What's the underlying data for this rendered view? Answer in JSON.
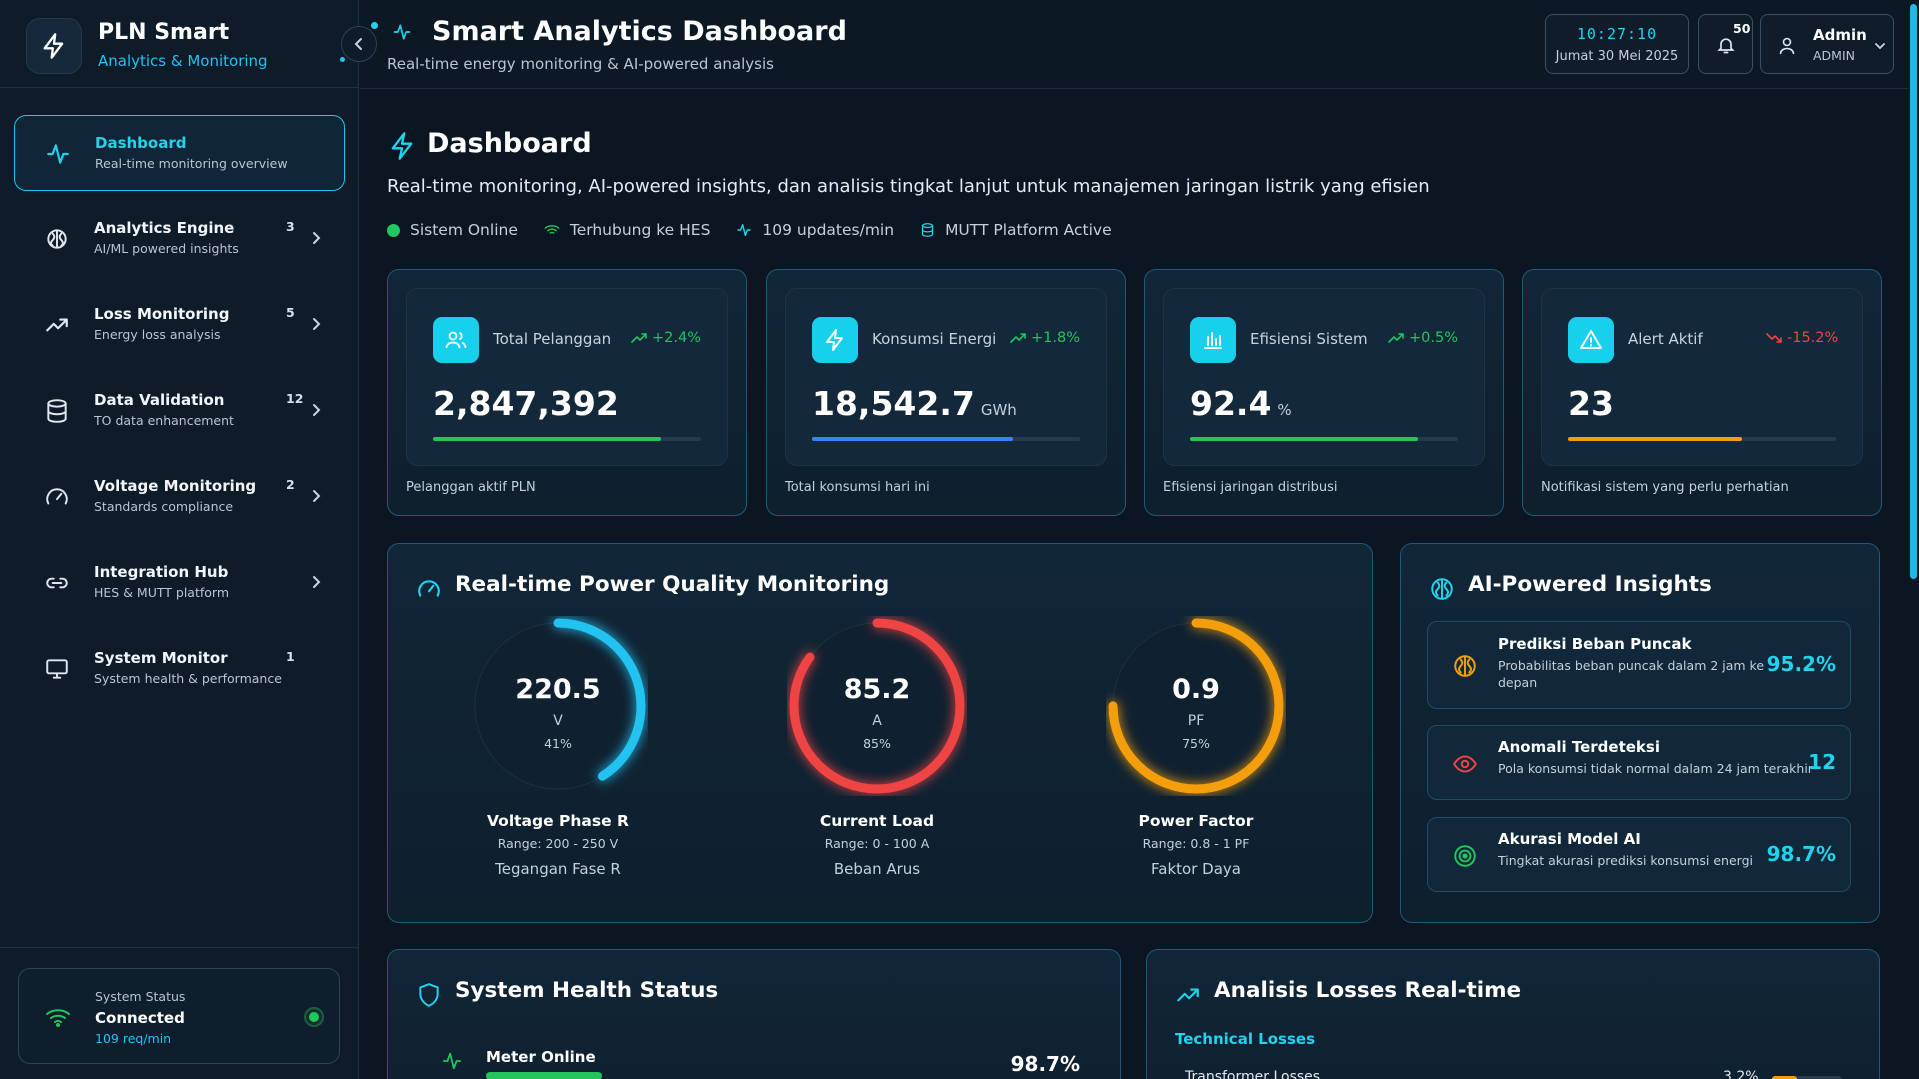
{
  "brand": {
    "title": "PLN Smart",
    "subtitle": "Analytics & Monitoring"
  },
  "sidebar": {
    "items": [
      {
        "label": "Dashboard",
        "desc": "Real-time monitoring overview",
        "badge": "",
        "icon": "activity-icon",
        "active": true
      },
      {
        "label": "Analytics Engine",
        "desc": "AI/ML powered insights",
        "badge": "3",
        "icon": "brain-icon"
      },
      {
        "label": "Loss Monitoring",
        "desc": "Energy loss analysis",
        "badge": "5",
        "icon": "trending-up-icon"
      },
      {
        "label": "Data Validation",
        "desc": "TO data enhancement",
        "badge": "12",
        "icon": "database-icon"
      },
      {
        "label": "Voltage Monitoring",
        "desc": "Standards compliance",
        "badge": "2",
        "icon": "gauge-icon"
      },
      {
        "label": "Integration Hub",
        "desc": "HES & MUTT platform",
        "badge": "",
        "icon": "link-icon"
      },
      {
        "label": "System Monitor",
        "desc": "System health & performance",
        "badge": "1",
        "icon": "monitor-icon"
      }
    ],
    "status": {
      "label": "System Status",
      "value": "Connected",
      "rate": "109 req/min"
    }
  },
  "header": {
    "title": "Smart Analytics Dashboard",
    "subtitle": "Real-time energy monitoring & AI-powered analysis",
    "time": "10:27:10",
    "date": "Jumat 30 Mei 2025",
    "notifications": "50",
    "user_name": "Admin",
    "user_role": "ADMIN"
  },
  "page": {
    "title": "Dashboard",
    "description": "Real-time monitoring, AI-powered insights, dan analisis tingkat lanjut untuk manajemen jaringan listrik yang efisien",
    "status_items": [
      "Sistem Online",
      "Terhubung ke HES",
      "109 updates/min",
      "MUTT Platform Active"
    ]
  },
  "kpis": [
    {
      "label": "Total Pelanggan",
      "trend": "+2.4%",
      "trend_dir": "up",
      "value": "2,847,392",
      "unit": "",
      "progress": 0.85,
      "color": "#22c55e",
      "footer": "Pelanggan aktif PLN",
      "icon": "users-icon"
    },
    {
      "label": "Konsumsi Energi",
      "trend": "+1.8%",
      "trend_dir": "up",
      "value": "18,542.7",
      "unit": "GWh",
      "progress": 0.75,
      "color": "#3b82f6",
      "footer": "Total konsumsi hari ini",
      "icon": "bolt-icon"
    },
    {
      "label": "Efisiensi Sistem",
      "trend": "+0.5%",
      "trend_dir": "up",
      "value": "92.4",
      "unit": "%",
      "progress": 0.85,
      "color": "#22c55e",
      "footer": "Efisiensi jaringan distribusi",
      "icon": "bar-chart-icon"
    },
    {
      "label": "Alert Aktif",
      "trend": "-15.2%",
      "trend_dir": "down",
      "value": "23",
      "unit": "",
      "progress": 0.65,
      "color": "#f59e0b",
      "footer": "Notifikasi sistem yang perlu perhatian",
      "icon": "alert-triangle-icon"
    }
  ],
  "power_quality": {
    "title": "Real-time Power Quality Monitoring",
    "gauges": [
      {
        "value": "220.5",
        "unit": "V",
        "percent_label": "41%",
        "percent": 0.41,
        "name": "Voltage Phase R",
        "range": "Range: 200 - 250 V",
        "sub": "Tegangan Fase R",
        "color": "#22c3f0"
      },
      {
        "value": "85.2",
        "unit": "A",
        "percent_label": "85%",
        "percent": 0.85,
        "name": "Current Load",
        "range": "Range: 0 - 100 A",
        "sub": "Beban Arus",
        "color": "#ef4444"
      },
      {
        "value": "0.9",
        "unit": "PF",
        "percent_label": "75%",
        "percent": 0.75,
        "name": "Power Factor",
        "range": "Range: 0.8 - 1 PF",
        "sub": "Faktor Daya",
        "color": "#f59e0b"
      }
    ]
  },
  "insights": {
    "title": "AI-Powered Insights",
    "items": [
      {
        "title": "Prediksi Beban Puncak",
        "desc": "Probabilitas beban puncak dalam 2 jam ke depan",
        "value": "95.2%",
        "icon": "brain-icon",
        "color": "#f59e0b"
      },
      {
        "title": "Anomali Terdeteksi",
        "desc": "Pola konsumsi tidak normal dalam 24 jam terakhir",
        "value": "12",
        "icon": "eye-icon",
        "color": "#ef4444"
      },
      {
        "title": "Akurasi Model AI",
        "desc": "Tingkat akurasi prediksi konsumsi energi",
        "value": "98.7%",
        "icon": "target-icon",
        "color": "#22c55e"
      }
    ]
  },
  "health": {
    "title": "System Health Status",
    "rows": [
      {
        "label": "Meter Online",
        "value": "98.7%",
        "progress": 0.987
      }
    ]
  },
  "losses": {
    "title": "Analisis Losses Real-time",
    "section": "Technical Losses",
    "rows": [
      {
        "label": "Transformer Losses",
        "value": "3.2%",
        "progress": 0.35
      }
    ]
  },
  "colors": {
    "accent": "#22c3f0",
    "success": "#22c55e",
    "danger": "#ef4444",
    "warning": "#f59e0b",
    "info": "#3b82f6"
  }
}
